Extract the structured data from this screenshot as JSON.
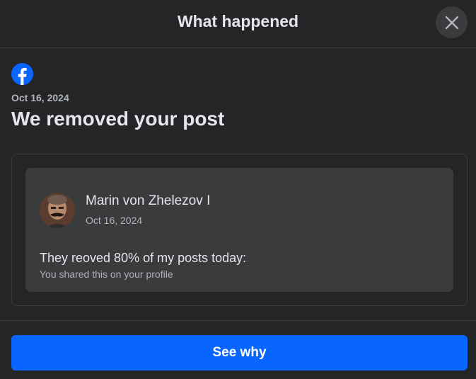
{
  "header": {
    "title": "What happened",
    "close_icon": "close-icon"
  },
  "notice": {
    "brand_icon": "facebook-logo-icon",
    "date": "Oct 16, 2024",
    "title": "We removed your post"
  },
  "post": {
    "author": "Marin von Zhelezov I",
    "date": "Oct 16, 2024",
    "text": "They reoved 80% of my posts today:",
    "subtext": "You shared this on your profile",
    "avatar_icon": "avatar"
  },
  "footer": {
    "button_label": "See why"
  },
  "colors": {
    "background": "#242526",
    "card": "#3a3b3c",
    "accent": "#0866ff",
    "text_primary": "#e4e6eb",
    "text_secondary": "#b0b3b8"
  }
}
